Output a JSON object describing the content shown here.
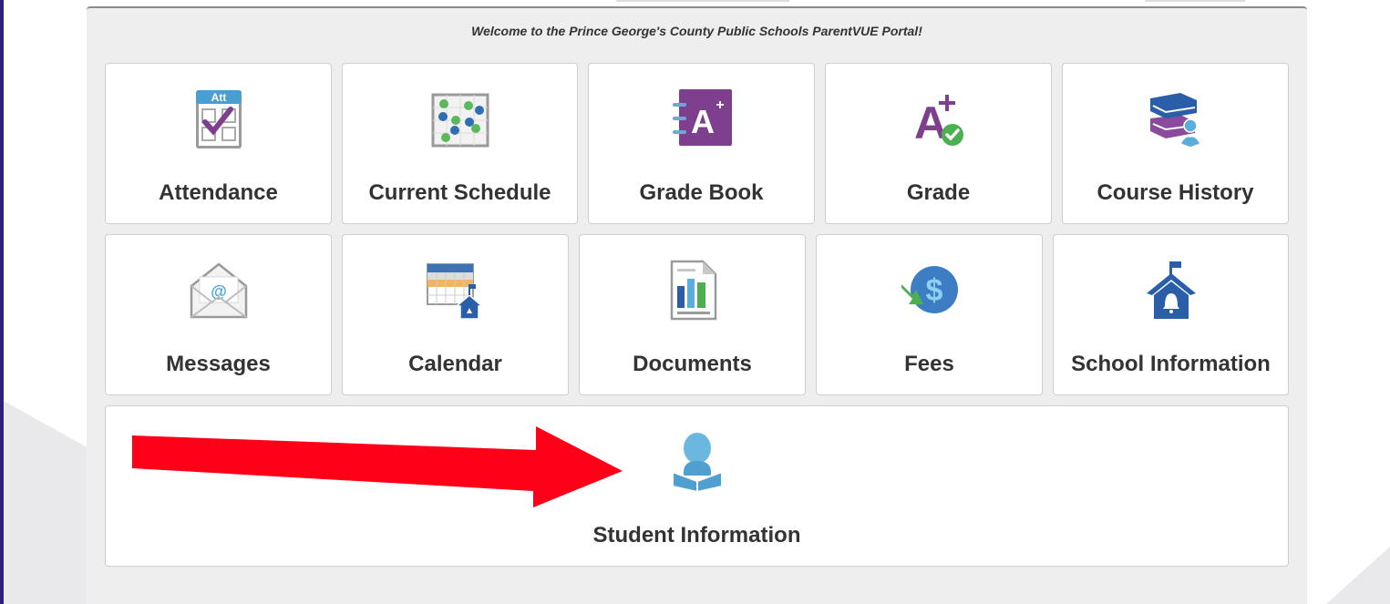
{
  "welcome_message": "Welcome to the Prince George's County Public Schools ParentVUE Portal!",
  "tiles_row1": [
    {
      "label": "Attendance",
      "icon": "attendance-icon"
    },
    {
      "label": "Current Schedule",
      "icon": "schedule-icon"
    },
    {
      "label": "Grade Book",
      "icon": "gradebook-icon"
    },
    {
      "label": "Grade",
      "icon": "grade-icon"
    },
    {
      "label": "Course History",
      "icon": "course-history-icon"
    }
  ],
  "tiles_row2": [
    {
      "label": "Messages",
      "icon": "envelope-icon"
    },
    {
      "label": "Calendar",
      "icon": "calendar-icon"
    },
    {
      "label": "Documents",
      "icon": "document-chart-icon"
    },
    {
      "label": "Fees",
      "icon": "dollar-icon"
    },
    {
      "label": "School Information",
      "icon": "school-icon"
    }
  ],
  "tiles_row3": [
    {
      "label": "Student Information",
      "icon": "student-reading-icon"
    }
  ],
  "annotation": {
    "type": "arrow",
    "color": "#ff0019",
    "points_to": "Student Information"
  },
  "colors": {
    "purple": "#7e3f8f",
    "blue": "#2f6db5",
    "light_blue": "#5aaedb",
    "green": "#4caf50",
    "orange": "#f5b461",
    "panel_bg": "#eeeeee",
    "text": "#333333"
  }
}
